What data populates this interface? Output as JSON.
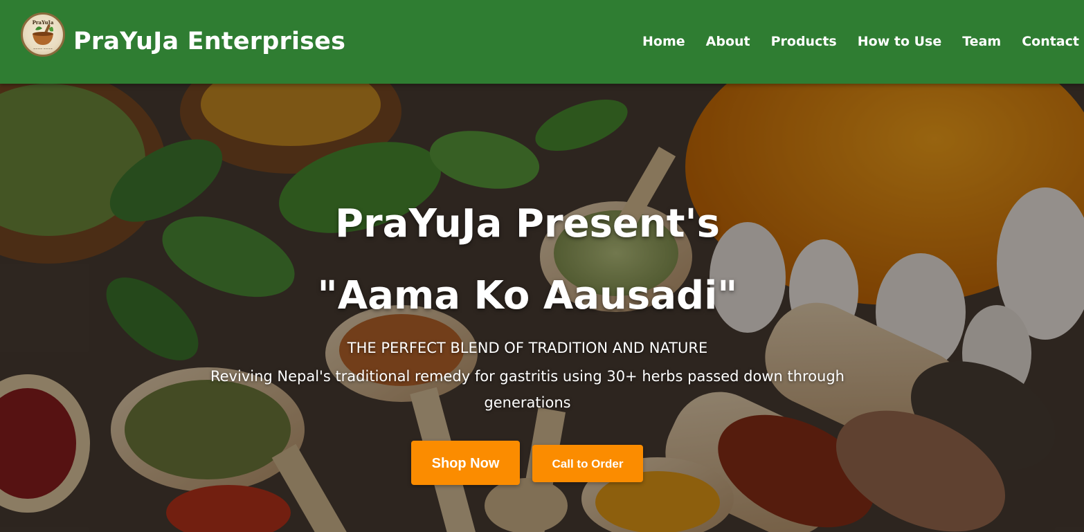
{
  "header": {
    "logo_alt": "PraYuJa",
    "brand": "PraYuJa Enterprises",
    "nav": [
      {
        "label": "Home"
      },
      {
        "label": "About"
      },
      {
        "label": "Products"
      },
      {
        "label": "How to Use"
      },
      {
        "label": "Team"
      },
      {
        "label": "Contact"
      }
    ]
  },
  "hero": {
    "title_line1": "PraYuJa Present's",
    "title_line2": "\"Aama Ko Aausadi\"",
    "tagline": "THE PERFECT BLEND OF TRADITION AND NATURE",
    "description": "Reviving Nepal's traditional remedy for gastritis using 30+ herbs passed down through generations",
    "buttons": {
      "shop": "Shop Now",
      "call": "Call to Order"
    }
  },
  "colors": {
    "header_bg": "#2f7d32",
    "button_bg": "#fb8c00",
    "text": "#ffffff"
  },
  "icons": {
    "logo": "mortar-pestle-logo"
  }
}
